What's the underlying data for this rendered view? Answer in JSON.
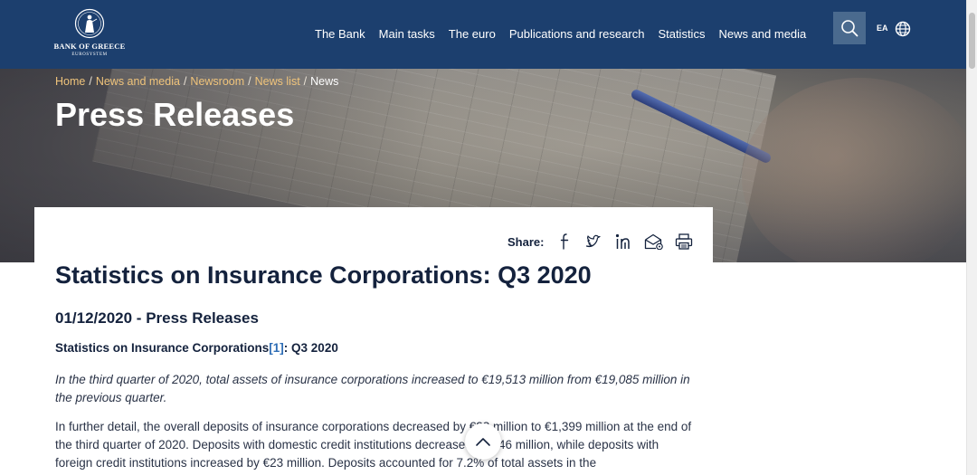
{
  "header": {
    "logo": {
      "name": "BANK OF GREECE",
      "sub": "EUROSYSTEM"
    },
    "nav": [
      {
        "label": "The Bank"
      },
      {
        "label": "Main tasks"
      },
      {
        "label": "The euro"
      },
      {
        "label": "Publications and research"
      },
      {
        "label": "Statistics"
      },
      {
        "label": "News and media"
      }
    ],
    "lang_label": "EA"
  },
  "hero": {
    "breadcrumb": [
      {
        "label": "Home"
      },
      {
        "label": "News and media"
      },
      {
        "label": "Newsroom"
      },
      {
        "label": "News list"
      }
    ],
    "breadcrumb_current": "News",
    "title": "Press Releases"
  },
  "share": {
    "label": "Share:",
    "icons": [
      "facebook-icon",
      "twitter-icon",
      "linkedin-icon",
      "email-icon",
      "print-icon"
    ]
  },
  "article": {
    "title": "Statistics on Insurance Corporations: Q3 2020",
    "date_line": "01/12/2020 - Press Releases",
    "subhead_text": "Statistics on Insurance Corporations",
    "subhead_ref": "[1]",
    "subhead_suffix": ": Q3 2020",
    "lead": "In the third quarter of 2020, total assets of insurance corporations increased to €19,513 million from €19,085 million in the previous quarter.",
    "body": "In further detail, the overall deposits of insurance corporations decreased by €23 million to €1,399 million at the end of the third quarter of 2020. Deposits with domestic credit institutions decreased by €46 million, while deposits with foreign credit institutions increased by €23 million. Deposits accounted for 7.2% of total assets in the"
  },
  "colors": {
    "header_bg": "#1c3f6e",
    "breadcrumb_link": "#f0c47b",
    "text_primary": "#14223d",
    "link": "#2e6db5"
  }
}
